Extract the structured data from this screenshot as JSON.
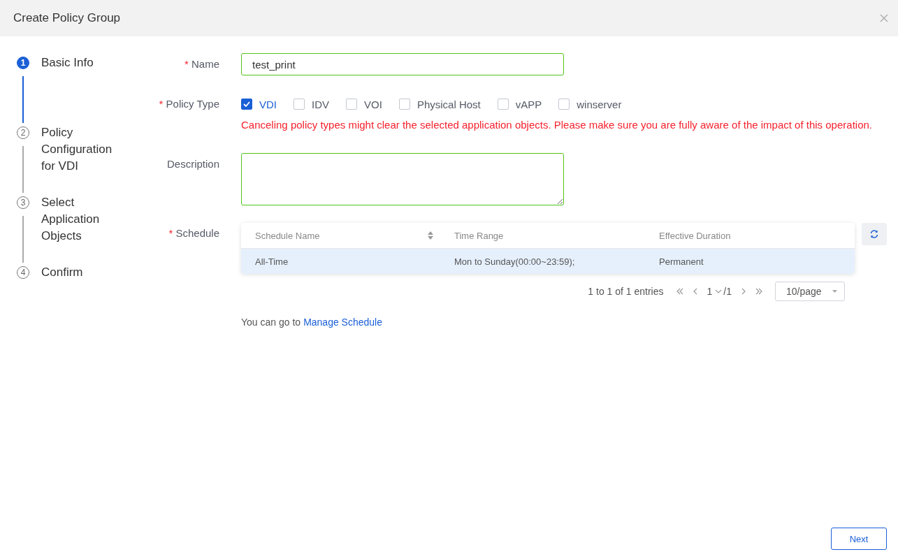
{
  "dialog": {
    "title": "Create Policy Group"
  },
  "steps": [
    {
      "number": "1",
      "label": "Basic Info",
      "selected": true
    },
    {
      "number": "2",
      "label": "Policy Configuration for VDI",
      "selected": false
    },
    {
      "number": "3",
      "label": "Select Application Objects",
      "selected": false
    },
    {
      "number": "4",
      "label": "Confirm",
      "selected": false
    }
  ],
  "form": {
    "name": {
      "required_mark": "*",
      "label": "Name",
      "value": "test_print"
    },
    "policy_type": {
      "required_mark": "*",
      "label": "Policy Type",
      "options": [
        {
          "label": "VDI",
          "checked": true
        },
        {
          "label": "IDV",
          "checked": false
        },
        {
          "label": "VOI",
          "checked": false
        },
        {
          "label": "Physical Host",
          "checked": false
        },
        {
          "label": "vAPP",
          "checked": false
        },
        {
          "label": "winserver",
          "checked": false
        }
      ],
      "warning": "Canceling policy types might clear the selected application objects. Please make sure you are fully aware of the impact of this operation."
    },
    "description": {
      "label": "Description"
    },
    "schedule": {
      "required_mark": "*",
      "label": "Schedule",
      "columns": [
        {
          "label": "Schedule Name",
          "sortable": true
        },
        {
          "label": "Time Range",
          "sortable": false
        },
        {
          "label": "Effective Duration",
          "sortable": false
        }
      ],
      "rows": [
        {
          "cells": [
            "All-Time",
            "Mon to Sunday(00:00~23:59);",
            "Permanent"
          ],
          "selected": true
        }
      ],
      "pagination": {
        "summary": "1 to 1 of 1 entries",
        "page": "1",
        "total": "/1",
        "page_size": "10/page"
      },
      "hint": "You can go to",
      "link": "Manage Schedule"
    }
  },
  "footer": {
    "next": "Next"
  }
}
